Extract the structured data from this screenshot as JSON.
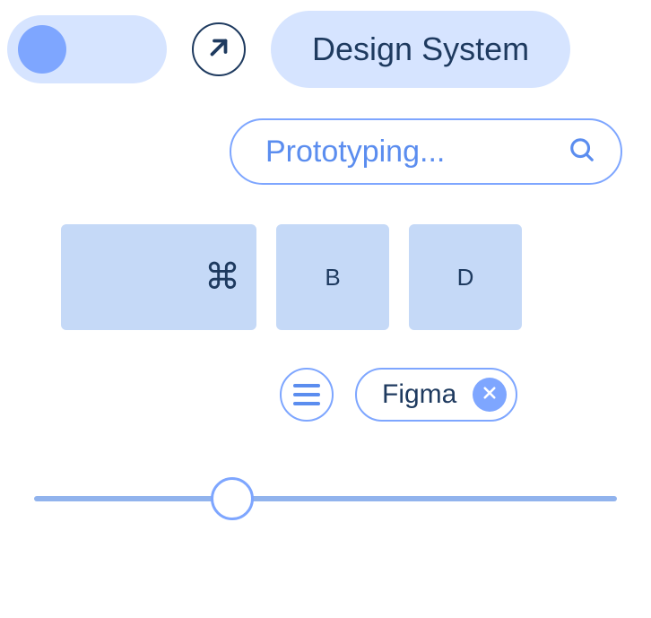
{
  "toggle": {
    "state": "off"
  },
  "pill": {
    "label": "Design System"
  },
  "search": {
    "placeholder": "Prototyping..."
  },
  "keys": {
    "cmd": "⌘",
    "b": "B",
    "d": "D"
  },
  "chip": {
    "label": "Figma"
  },
  "slider": {
    "value": 34
  },
  "colors": {
    "accent_light": "#d6e4ff",
    "accent_mid": "#7ea6ff",
    "accent_blue": "#5b8def",
    "text_dark": "#1e3a5f",
    "key_bg": "#c5d9f7"
  }
}
